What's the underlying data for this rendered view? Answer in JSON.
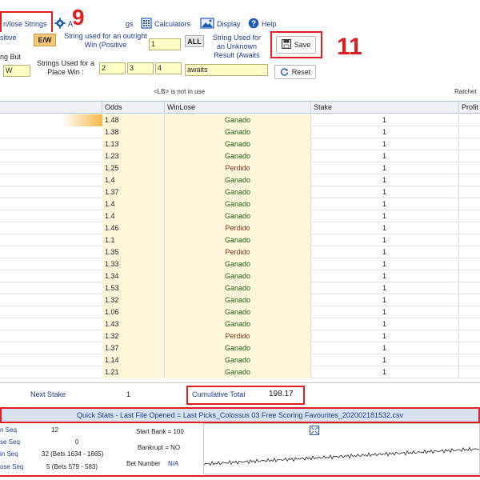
{
  "menu": {
    "winlose_label": "n/lose Strings",
    "settings_label": "A",
    "settings_partial": "gs",
    "calculators_label": "Calculators",
    "display_label": "Display",
    "help_label": "Help"
  },
  "annotations": {
    "nine": "9",
    "eleven": "11"
  },
  "toolbar": {
    "left_label_1": "sitive",
    "left_label_2": "ng But",
    "ew_button": "E/W",
    "outright_label": "String used for an outright Win (Positive",
    "outright_value": "1",
    "all_button": "ALL",
    "unknown_label": "String Used for an Unknown Result  (Awaits",
    "save_label": "Save",
    "place_label": "Strings Used for a Place Win :",
    "place_values": [
      "2",
      "3",
      "4"
    ],
    "w_value": "W",
    "awaits_value": "awaits",
    "reset_label": "Reset"
  },
  "info": {
    "lb_note": "<LB> is not in use",
    "ratchet_label": "Ratchet"
  },
  "grid": {
    "headers": [
      "Odds",
      "WinLose",
      "Stake",
      "Profit"
    ],
    "rows": [
      {
        "odds": "1.48",
        "wl": "Ganado",
        "stake": "1"
      },
      {
        "odds": "1.38",
        "wl": "Ganado",
        "stake": "1"
      },
      {
        "odds": "1.13",
        "wl": "Ganado",
        "stake": "1"
      },
      {
        "odds": "1.23",
        "wl": "Ganado",
        "stake": "1"
      },
      {
        "odds": "1.25",
        "wl": "Perdido",
        "stake": "1"
      },
      {
        "odds": "1.4",
        "wl": "Ganado",
        "stake": "1"
      },
      {
        "odds": "1.37",
        "wl": "Ganado",
        "stake": "1"
      },
      {
        "odds": "1.4",
        "wl": "Ganado",
        "stake": "1"
      },
      {
        "odds": "1.4",
        "wl": "Ganado",
        "stake": "1"
      },
      {
        "odds": "1.46",
        "wl": "Perdido",
        "stake": "1"
      },
      {
        "odds": "1.1",
        "wl": "Ganado",
        "stake": "1"
      },
      {
        "odds": "1.35",
        "wl": "Perdido",
        "stake": "1"
      },
      {
        "odds": "1.33",
        "wl": "Ganado",
        "stake": "1"
      },
      {
        "odds": "1.34",
        "wl": "Ganado",
        "stake": "1"
      },
      {
        "odds": "1.53",
        "wl": "Ganado",
        "stake": "1"
      },
      {
        "odds": "1.32",
        "wl": "Ganado",
        "stake": "1"
      },
      {
        "odds": "1.06",
        "wl": "Ganado",
        "stake": "1"
      },
      {
        "odds": "1.43",
        "wl": "Ganado",
        "stake": "1"
      },
      {
        "odds": "1.32",
        "wl": "Perdido",
        "stake": "1"
      },
      {
        "odds": "1.37",
        "wl": "Ganado",
        "stake": "1"
      },
      {
        "odds": "1.14",
        "wl": "Ganado",
        "stake": "1"
      },
      {
        "odds": "1.21",
        "wl": "Ganado",
        "stake": "1"
      }
    ]
  },
  "summary": {
    "next_stake_label": "Next Stake",
    "next_stake_value": "1",
    "cumulative_label": "Cumulative Total",
    "cumulative_value": "198.17"
  },
  "quick_stats": {
    "title": "Quick Stats - Last File Opened = Last Picks_Colossus 03 Free Scoring Favourites_202002181532.csv",
    "win_seq_label": "n Seq",
    "win_seq_value": "12",
    "lose_seq_label": "se Seq",
    "lose_seq_value": "0",
    "win_seq2_label": "in Seq",
    "win_seq2_value": "32  (Bets 1634 - 1665)",
    "lose_seq2_label": "ose Seq",
    "lose_seq2_value": "5  (Bets 579 - 583)",
    "start_bank_label": "Start Bank = 100",
    "bankrupt_label": "Bankrupt = NO",
    "bet_number_label": "Bet Number",
    "bet_number_value": "N/A"
  },
  "colors": {
    "annotation_red": "#e02020",
    "link_blue": "#1a3d8f",
    "yellow_field": "#ffffc8",
    "ganado_green": "#1a5e1a"
  }
}
